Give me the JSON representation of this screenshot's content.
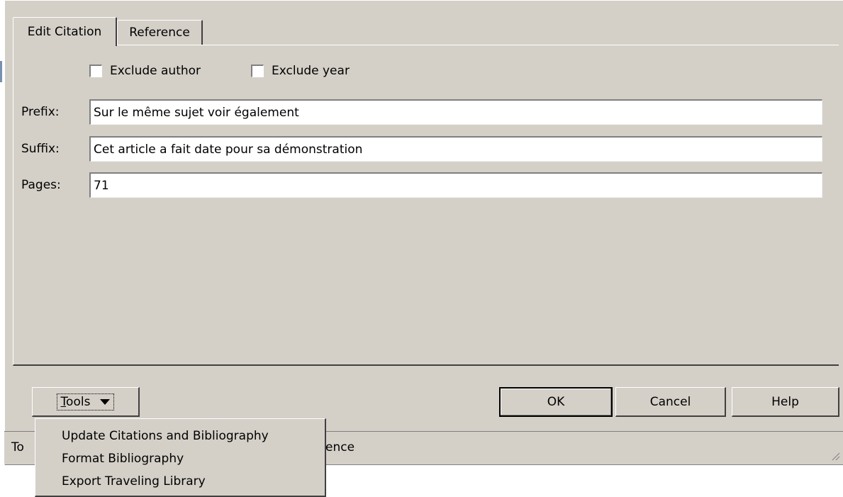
{
  "tabs": [
    {
      "label": "Edit Citation",
      "active": true
    },
    {
      "label": "Reference",
      "active": false
    }
  ],
  "checkboxes": {
    "exclude_author": {
      "label": "Exclude author",
      "checked": false
    },
    "exclude_year": {
      "label": "Exclude year",
      "checked": false
    }
  },
  "fields": {
    "prefix": {
      "label": "Prefix:",
      "value": "Sur le même sujet voir également"
    },
    "suffix": {
      "label": "Suffix:",
      "value": "Cet article a fait date pour sa démonstration"
    },
    "pages": {
      "label": "Pages:",
      "value": "71"
    }
  },
  "buttons": {
    "tools_label": "Tools",
    "tools_accel": "T",
    "tools_rest": "ools",
    "ok_label": "OK",
    "cancel_label": "Cancel",
    "help_label": "Help"
  },
  "tools_menu": {
    "items": [
      {
        "label": "Update Citations and Bibliography"
      },
      {
        "label": "Format Bibliography"
      },
      {
        "label": "Export Traveling Library"
      }
    ]
  },
  "status_bar": {
    "left_fragment": "To",
    "right_fragment": "ence"
  },
  "icons": {
    "dropdown": "chevron-down-icon",
    "resize": "resize-grip-icon"
  },
  "colors": {
    "dialog_bg": "#d4d0c8",
    "highlight": "#ffffff",
    "shadow": "#404040"
  }
}
